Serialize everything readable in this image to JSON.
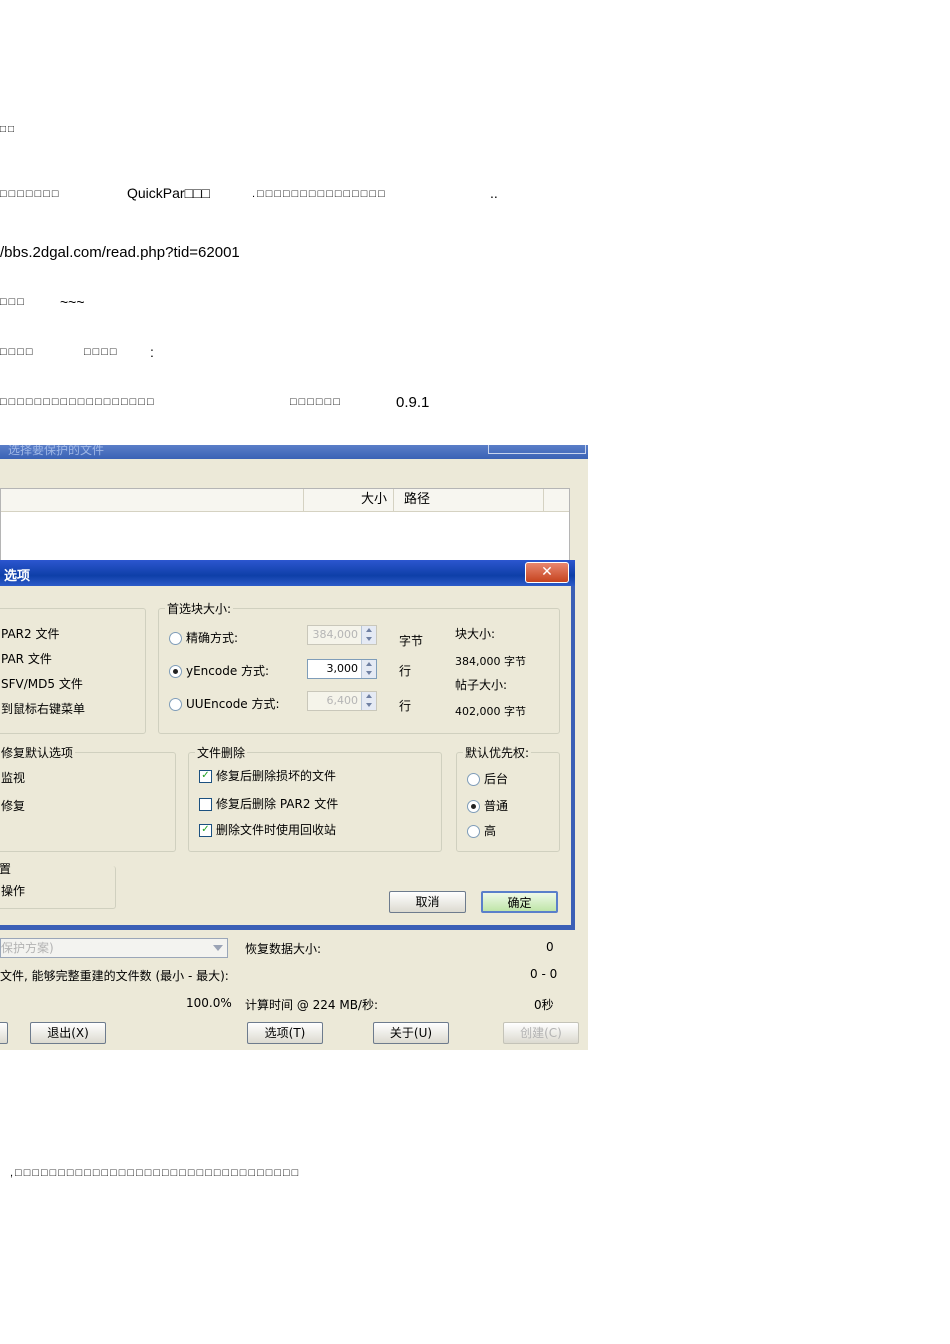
{
  "document": {
    "line1": "□□",
    "line2_a": "□□□□□□□",
    "line2_b": "QuickPar□□□",
    "line2_c": ".□□□□□□□□□□□□□□□",
    "line2_d": "..",
    "line3": "/bbs.2dgal.com/read.php?tid=62001",
    "line4_a": "□□□",
    "line4_b": "~~~",
    "line5_a": "□□□□",
    "line5_b": "□□□□",
    "line5_c": ":",
    "line6_a": "□□□□□□□□□□□□□□□□□□",
    "line6_b": "□□□□□□",
    "line6_c": "0.9.1",
    "footer": ",□□□□□□□□□□□□□□□□□□□□□□□□□□□□□□□□□"
  },
  "main_window": {
    "title": "选择要保护的文件",
    "columns": {
      "size": "大小",
      "path": "路径"
    },
    "scheme_combo": "保护方案)",
    "recovery_size_label": "恢复数据大小:",
    "recovery_size_value": "0",
    "rebuild_label": "文件, 能够完整重建的文件数 (最小 - 最大):",
    "rebuild_value": "0 - 0",
    "percent": "100.0%",
    "calc_time_label": "计算时间 @ 224 MB/秒:",
    "calc_time_value": "0秒",
    "buttons": {
      "exit": "退出(X)",
      "options": "选项(T)",
      "about": "关于(U)",
      "create": "创建(C)"
    }
  },
  "options_dialog": {
    "title": "选项",
    "close": "✕",
    "assoc_items": [
      "PAR2 文件",
      "PAR 文件",
      "SFV/MD5 文件",
      "到鼠标右键菜单"
    ],
    "block_size_group": "首选块大小:",
    "modes": [
      {
        "label": "精确方式:",
        "value": "384,000",
        "unit": "字节",
        "selected": false,
        "enabled": false
      },
      {
        "label": "yEncode 方式:",
        "value": "3,000",
        "unit": "行",
        "selected": true,
        "enabled": true
      },
      {
        "label": "UUEncode 方式:",
        "value": "6,400",
        "unit": "行",
        "selected": false,
        "enabled": false
      }
    ],
    "block_size_label": "块大小:",
    "block_size_value": "384,000 字节",
    "post_size_label": "帖子大小:",
    "post_size_value": "402,000 字节",
    "repair_group": "修复默认选项",
    "repair_items": [
      "监视",
      "修复"
    ],
    "delete_group": "文件删除",
    "delete_items": [
      {
        "label": "修复后删除损坏的文件",
        "checked": true
      },
      {
        "label": "修复后删除 PAR2 文件",
        "checked": false
      },
      {
        "label": "删除文件时使用回收站",
        "checked": true
      }
    ],
    "priority_group": "默认优先权:",
    "priority_items": [
      {
        "label": "后台",
        "selected": false
      },
      {
        "label": "普通",
        "selected": true
      },
      {
        "label": "高",
        "selected": false
      }
    ],
    "misc_group": "置",
    "misc_item": "操作",
    "cancel": "取消",
    "ok": "确定"
  }
}
